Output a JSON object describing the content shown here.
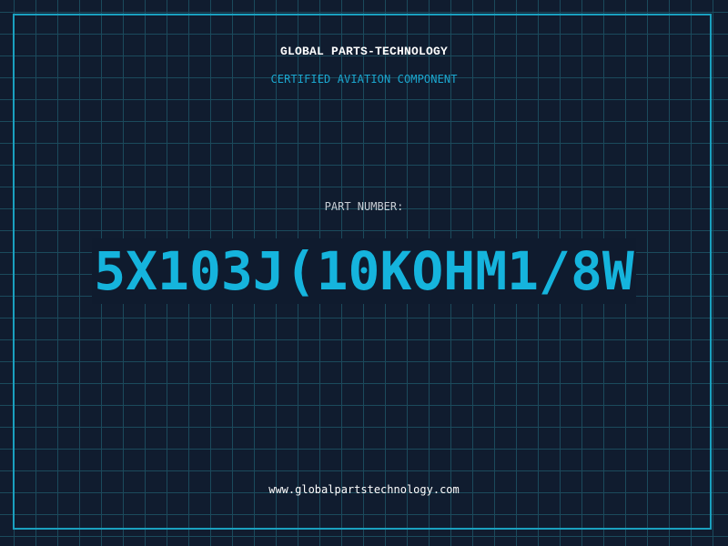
{
  "header": {
    "company": "GLOBAL PARTS-TECHNOLOGY",
    "subtitle": "CERTIFIED AVIATION COMPONENT"
  },
  "part": {
    "label": "PART NUMBER:",
    "number": "5X103J(10KOHM1/8W"
  },
  "footer": {
    "url": "www.globalpartstechnology.com"
  },
  "colors": {
    "background": "#101c2f",
    "grid": "#1b4a5c",
    "accent": "#15b4dd",
    "frame": "#1aa0bf"
  }
}
